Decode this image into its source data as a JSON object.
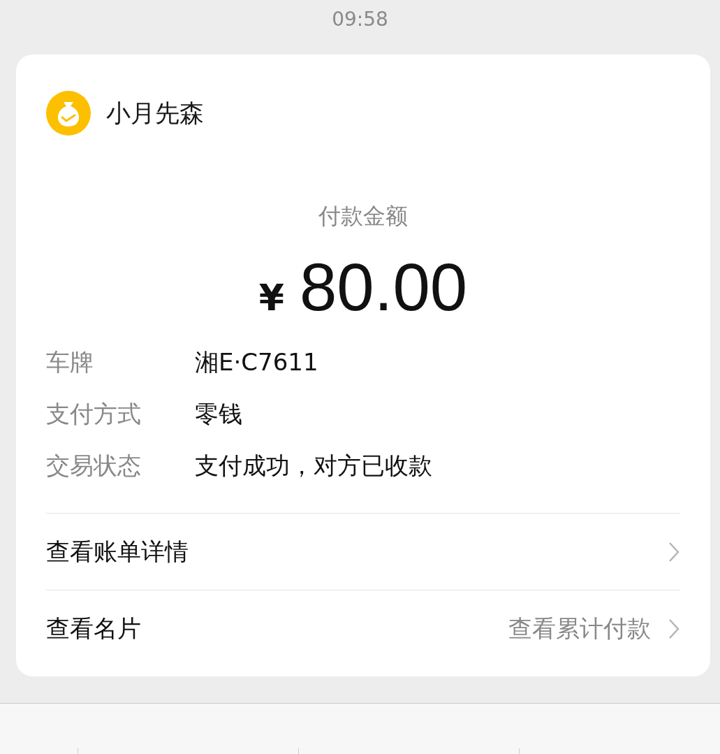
{
  "status_bar": {
    "time": "09:58"
  },
  "merchant": {
    "name": "小月先森"
  },
  "payment": {
    "label": "付款金额",
    "currency": "¥",
    "amount": "80.00"
  },
  "details": [
    {
      "label": "车牌",
      "value": "湘E·C7611"
    },
    {
      "label": "支付方式",
      "value": "零钱"
    },
    {
      "label": "交易状态",
      "value": "支付成功，对方已收款"
    }
  ],
  "links": [
    {
      "label": "查看账单详情"
    },
    {
      "label": "查看名片",
      "extra": "查看累计付款"
    }
  ]
}
